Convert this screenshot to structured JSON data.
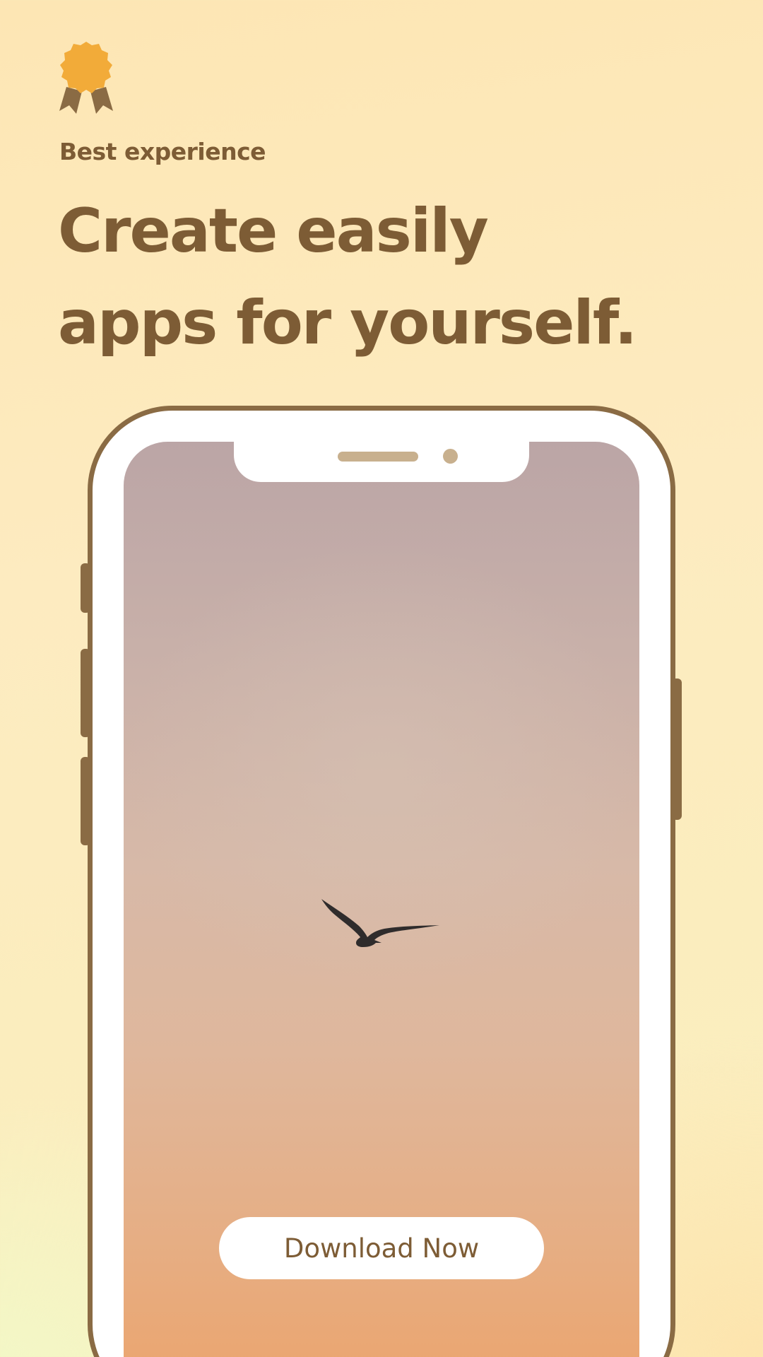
{
  "badge": {
    "icon": "award-ribbon-icon",
    "color": "#f2ab39",
    "ribbon_color": "#8a6b44"
  },
  "subtitle": "Best experience",
  "headline": {
    "line1": "Create easily",
    "line2": "apps for yourself."
  },
  "phone": {
    "frame_color": "#8a6b44",
    "screen_image": "bird-in-sunset-sky",
    "cta": {
      "label": "Download Now"
    }
  },
  "colors": {
    "text_brown": "#7d5c35",
    "accent_orange": "#f2ab39",
    "background_cream": "#fdebc0"
  }
}
